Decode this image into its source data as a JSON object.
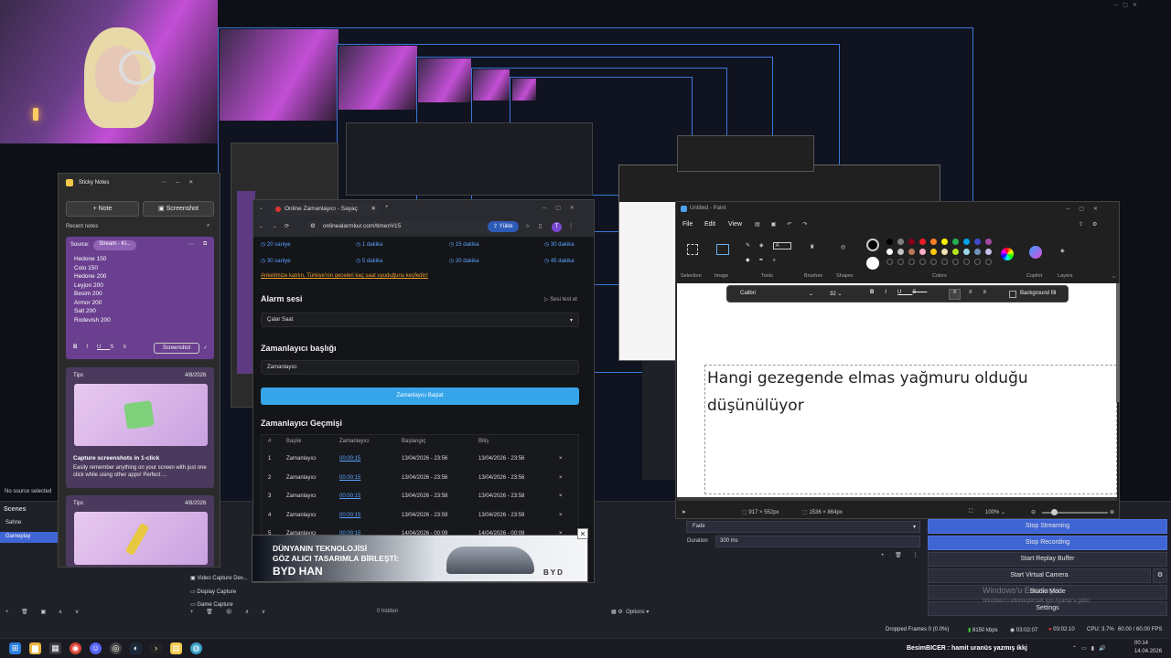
{
  "sticky_notes": {
    "title": "Sticky Notes",
    "note_button": "+ Note",
    "screenshot_button": "Screenshot",
    "recent_label": "Recent notes",
    "source_label": "Source:",
    "source_chip": "Stream - Ki...",
    "note_lines": [
      "Hedone 150",
      "Colo 150",
      "Hedone 200",
      "Leyjon 200",
      "Besim 200",
      "Armor 200",
      "Salt 200",
      "Rodevish 200"
    ],
    "toolbar_screenshot": "Screenshot",
    "tip_label": "Tips",
    "tip_date": "4/8/2026",
    "tip_title": "Capture screenshots in 1-click",
    "tip_body": "Easily remember anything on your screen with just one click while using other apps! Perfect ...",
    "tip2_label": "Tips",
    "tip2_date": "4/8/2026"
  },
  "browser": {
    "tab_title": "Online Zamanlayıcı - Sayaç",
    "url": "onlinealarmkur.com/timer/#15",
    "upload_label": "Yükle",
    "quick_times": [
      "20 saniye",
      "1 dakika",
      "15 dakika",
      "30 dakika",
      "30 saniye",
      "5 dakika",
      "20 dakika",
      "45 dakika"
    ],
    "survey_link": "Anketimize katılın, Türkiye'nin geceleri kaç saat uyuduğunu keşfedin!",
    "alarm_heading": "Alarm sesi",
    "sound_test": "Sesi test et",
    "alarm_value": "Çalar Saat",
    "timer_title_heading": "Zamanlayıcı başlığı",
    "timer_title_value": "Zamanlayıcı",
    "start_button": "Zamanlayıcı Başlat",
    "history_heading": "Zamanlayıcı Geçmişi",
    "columns": [
      "#",
      "Başlık",
      "Zamanlayıcı",
      "Başlangıç",
      "Bitiş"
    ],
    "rows": [
      [
        "1",
        "Zamanlayıcı",
        "00:00:15",
        "13/04/2026 - 23:56",
        "13/04/2026 - 23:56"
      ],
      [
        "2",
        "Zamanlayıcı",
        "00:00:15",
        "13/04/2026 - 23:56",
        "13/04/2026 - 23:56"
      ],
      [
        "3",
        "Zamanlayıcı",
        "00:00:15",
        "13/04/2026 - 23:58",
        "13/04/2026 - 23:58"
      ],
      [
        "4",
        "Zamanlayıcı",
        "00:00:15",
        "13/04/2026 - 23:59",
        "13/04/2026 - 23:59"
      ],
      [
        "5",
        "Zamanlayıcı",
        "00:00:15",
        "14/04/2026 - 00:09",
        "14/04/2026 - 00:09"
      ]
    ]
  },
  "ad": {
    "line1": "DÜNYANIN TEKNOLOJİSİ",
    "line2": "GÖZ ALICI TASARIMLA BİRLEŞTİ:",
    "line3": "BYD HAN",
    "brand": "BYD"
  },
  "paint": {
    "title": "Untitled - Paint",
    "menu": [
      "File",
      "Edit",
      "View"
    ],
    "groups": [
      "Selection",
      "Image",
      "Tools",
      "Brushes",
      "Shapes",
      "Colors",
      "Copilot",
      "Layers"
    ],
    "font": "Calibri",
    "font_size": "32",
    "background_fill": "Background fill",
    "canvas_text_1": "Hangi gezegende elmas yağmuru olduğu",
    "canvas_text_2": "düşünülüyor",
    "selection_size": "917 × 552px",
    "canvas_size": "1536 × 864px",
    "zoom": "100%"
  },
  "obs": {
    "no_source": "No source selected",
    "scenes_label": "Scenes",
    "scenes": [
      "Sahne",
      "Gameplay"
    ],
    "sources": [
      "Video Capture Dev...",
      "Display Capture",
      "Game Capture"
    ],
    "transition": "Fade",
    "duration_label": "Duration",
    "duration_value": "300 ms",
    "hidden": "0 hidden",
    "options": "Options",
    "controls": [
      "Stop Streaming",
      "Stop Recording",
      "Start Replay Buffer",
      "Start Virtual Camera",
      "Studio Mode",
      "Settings"
    ],
    "watermark_1": "Windows'u Etkinleştir",
    "watermark_2": "Windows'u etkinleştirmek için Ayarlar'a gidin.",
    "status": [
      "Dropped Frames 0 (0.0%)",
      "8150 kbps",
      "03:02:07",
      "03:02:10",
      "CPU: 3.7%",
      "60.00 / 60.00 FPS"
    ]
  },
  "taskbar": {
    "marquee": "BesimBICER : hamit uranüs yazmış ikkj",
    "time": "00:14",
    "date": "14.04.2026"
  },
  "colors": {
    "accent": "#3f64d4",
    "button_blue": "#2f9ae9",
    "link": "#5aa2ff",
    "note_purple": "#6a3f8f",
    "survey_orange": "#f0a030"
  }
}
